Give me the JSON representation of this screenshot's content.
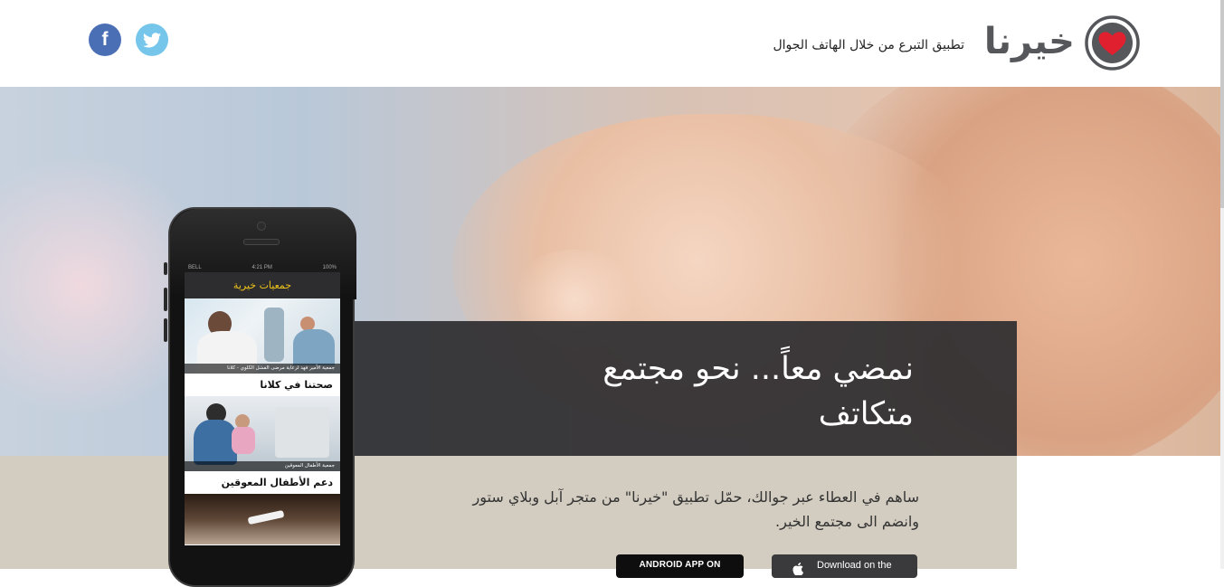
{
  "header": {
    "logo_text": "خيرنا",
    "tagline": "تطبيق التبرع من خلال الهاتف الجوال",
    "social": {
      "twitter_icon": "twitter-icon",
      "facebook_label": "f"
    }
  },
  "hero": {
    "headline": "نمضي معاً... نحو مجتمع متكاتف",
    "description": "ساهم في العطاء عبر جوالك، حمّل تطبيق \"خيرنا\" من متجر آبل وبلاي ستور وانضم الى مجتمع الخير.",
    "store_buttons": {
      "apple_label": "Download on the",
      "android_label": "ANDROID APP ON"
    }
  },
  "phone": {
    "status": {
      "carrier": "BELL",
      "time": "4:21 PM",
      "battery": "100%"
    },
    "app_title": "جمعيات خيرية",
    "cards": [
      {
        "caption": "جمعية الأمير فهد لرعاية مرضى الفشل الكلوي - كلانا",
        "title": "صحتنا في كلانا"
      },
      {
        "caption": "جمعية الأطفال المعوقين",
        "title": "دعم الأطفال المعوقين"
      }
    ]
  },
  "colors": {
    "brand_heart": "#e0202e",
    "logo_gray": "#55575b",
    "facebook": "#4a6fb5",
    "twitter": "#76c6ec",
    "panel_dark": "#2d2d30",
    "band_beige": "#d3ccc0",
    "app_title_yellow": "#f0c419"
  }
}
